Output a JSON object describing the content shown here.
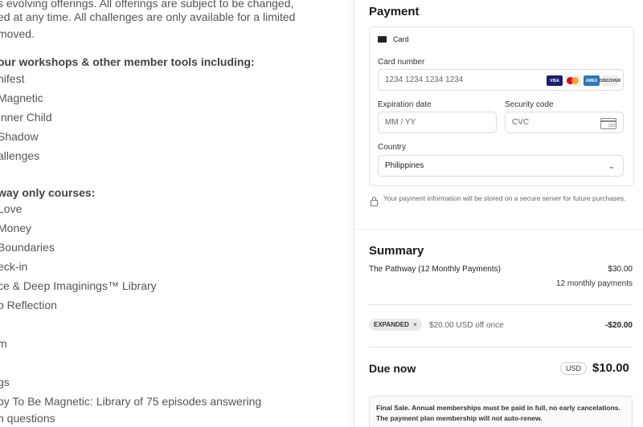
{
  "left": {
    "lines": [
      {
        "text": "s evolving offerings. All offerings are subject to be changed,",
        "bold": false
      },
      {
        "text": "ed at any time. All challenges are only available for a limited",
        "bold": false
      },
      {
        "text": "moved.",
        "bold": false
      },
      {
        "text": "our workshops & other member tools including:",
        "bold": true
      },
      {
        "text": "nifest",
        "bold": false
      },
      {
        "text": "Magnetic",
        "bold": false
      },
      {
        "text": "Inner Child",
        "bold": false
      },
      {
        "text": "Shadow",
        "bold": false
      },
      {
        "text": "allenges",
        "bold": false
      },
      {
        "text": "way only courses:",
        "bold": true
      },
      {
        "text": "Love",
        "bold": false
      },
      {
        "text": "Money",
        "bold": false
      },
      {
        "text": "Boundaries",
        "bold": false
      },
      {
        "text": "eck-in",
        "bold": false
      },
      {
        "text": "ce & Deep Imaginings™ Library",
        "bold": false
      },
      {
        "text": "p Reflection",
        "bold": false
      },
      {
        "text": "m",
        "bold": false
      },
      {
        "text": "gs",
        "bold": false
      },
      {
        "text": "by To Be Magnetic: Library of 75 episodes answering",
        "bold": false
      },
      {
        "text": "n questions",
        "bold": false
      }
    ]
  },
  "payment": {
    "title": "Payment",
    "tab_label": "Card",
    "card_number_label": "Card number",
    "card_number_placeholder": "1234 1234 1234 1234",
    "brands": [
      "VISA",
      "",
      "AMEX",
      "DISCOVER"
    ],
    "expiry_label": "Expiration date",
    "expiry_placeholder": "MM / YY",
    "cvc_label": "Security code",
    "cvc_placeholder": "CVC",
    "cvc_icon_text": "123",
    "country_label": "Country",
    "country_value": "Philippines",
    "secure_note": "Your payment information will be stored on a secure server for future purchases."
  },
  "summary": {
    "title": "Summary",
    "item_name": "The Pathway (12 Monthly Payments)",
    "item_price": "$30.00",
    "item_sub": "12 monthly payments",
    "promo_code": "EXPANDED",
    "promo_remove": "×",
    "promo_desc": "$20.00 USD off once",
    "promo_amount": "-$20.00",
    "due_label": "Due now",
    "currency": "USD",
    "due_amount": "$10.00",
    "final_note": "Final Sale. Annual memberships must be paid in full, no early cancelations. The payment plan membership will not auto-renew."
  }
}
